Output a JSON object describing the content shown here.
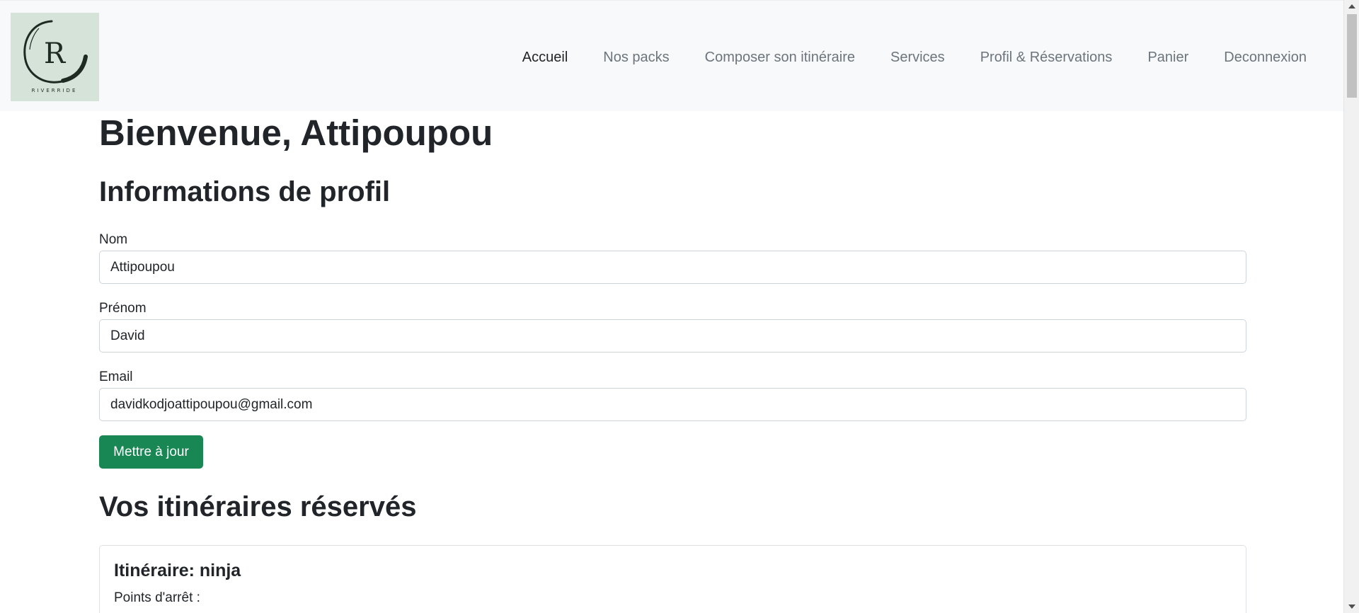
{
  "brand": {
    "logo_letter": "R",
    "logo_text": "RIVERRIDE",
    "logo_bg": "#d6e3d8"
  },
  "nav": {
    "items": [
      {
        "label": "Accueil",
        "active": true
      },
      {
        "label": "Nos packs",
        "active": false
      },
      {
        "label": "Composer son itinéraire",
        "active": false
      },
      {
        "label": "Services",
        "active": false
      },
      {
        "label": "Profil & Réservations",
        "active": false
      },
      {
        "label": "Panier",
        "active": false
      },
      {
        "label": "Deconnexion",
        "active": false
      }
    ]
  },
  "main": {
    "welcome": "Bienvenue, Attipoupou",
    "profile_title": "Informations de profil",
    "fields": {
      "nom": {
        "label": "Nom",
        "value": "Attipoupou"
      },
      "prenom": {
        "label": "Prénom",
        "value": "David"
      },
      "email": {
        "label": "Email",
        "value": "davidkodjoattipoupou@gmail.com"
      }
    },
    "update_button": "Mettre à jour",
    "reservations_title": "Vos itinéraires réservés",
    "reservation": {
      "title": "Itinéraire: ninja",
      "stops_label": "Points d'arrêt :"
    }
  },
  "colors": {
    "navbar_bg": "#f8f9fa",
    "button_success": "#198754",
    "nav_inactive": "#6c757d",
    "nav_active": "#212529"
  },
  "icons": {
    "scroll_up": "triangle-up-icon",
    "scroll_down": "triangle-down-icon"
  }
}
